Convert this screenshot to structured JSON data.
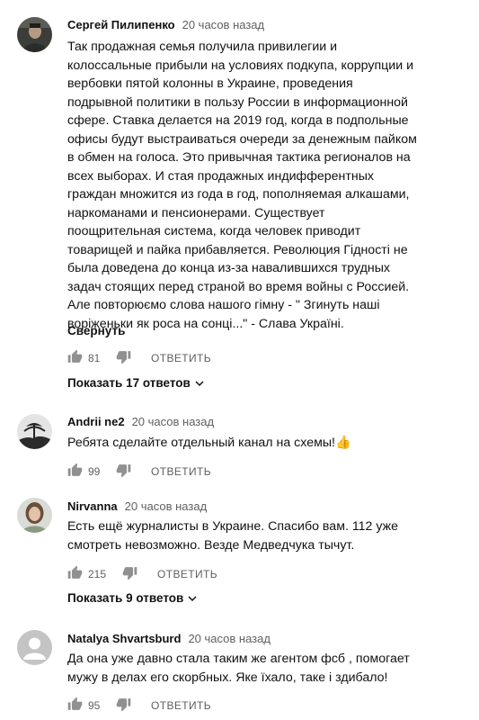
{
  "comments": [
    {
      "author": "Сергей Пилипенко",
      "time": "20 часов назад",
      "lines": [
        "Так продажная семья получила привилегии и",
        "колоссальные прибыли на условиях подкупа, коррупции и",
        "вербовки пятой колонны в Украине, проведения",
        "подрывной политики в пользу России в информационной",
        "сфере. Ставка делается на 2019 год, когда в подпольные",
        "офисы будут выстраиваться очереди за денежным пайком",
        "в обмен на голоса. Это привычная тактика регионалов на",
        "всех выборах. И стая продажных индифферентных",
        "граждан множится из года в год, пополняемая алкашами,",
        "наркоманами и пенсионерами. Существует",
        "поощрительная система, когда человек приводит",
        "товарищей и пайка прибавляется. Революция Гідності не",
        "была доведена до конца из-за навалившихся трудных",
        "задач стоящих перед страной во время войны с Россией.",
        "Але повторюємо слова нашого гімну - \" Згинуть наші",
        "воріженьки як роса на сонці...\" - Слава Україні."
      ],
      "collapse_label": "Свернуть",
      "likes": "81",
      "reply_label": "ОТВЕТИТЬ",
      "show_replies": "Показать 17 ответов"
    },
    {
      "author": "Andrii ne2",
      "time": "20 часов назад",
      "lines": [
        "Ребята сделайте отдельный канал на схемы!👍"
      ],
      "likes": "99",
      "reply_label": "ОТВЕТИТЬ"
    },
    {
      "author": "Nirvanna",
      "time": "20 часов назад",
      "lines": [
        "Есть ещё журналисты в Украине. Спасибо вам. 112 уже",
        "смотреть невозможно. Везде Медведчука тычут."
      ],
      "likes": "215",
      "reply_label": "ОТВЕТИТЬ",
      "show_replies": "Показать 9 ответов"
    },
    {
      "author": "Natalya Shvartsburd",
      "time": "20 часов назад",
      "lines": [
        "Да она уже давно стала таким же агентом фсб , помогает",
        "мужу в делах его скорбных. Яке їхало, таке і  здибало!"
      ],
      "likes": "95",
      "reply_label": "ОТВЕТИТЬ"
    }
  ],
  "icons": {
    "like": "thumb-up-icon",
    "dislike": "thumb-down-icon",
    "expand": "chevron-down-icon"
  },
  "colors": {
    "meta": "#606060",
    "text": "#111111",
    "icon": "#909090"
  }
}
